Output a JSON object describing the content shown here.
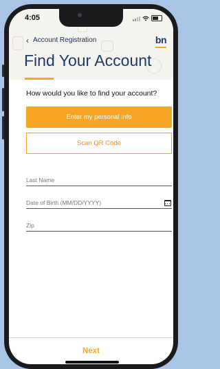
{
  "status_bar": {
    "time": "4:05"
  },
  "header": {
    "back_label": "Account Registration",
    "logo": "bn",
    "title": "Find Your Account"
  },
  "progress": {
    "steps": 5,
    "active_step": 1
  },
  "form": {
    "question": "How would you like to find your account?",
    "option_personal_info": "Enter my personal info",
    "option_qr": "Scan QR Code",
    "last_name_placeholder": "Last Name",
    "dob_placeholder": "Date of Birth (MM/DD/YYYY)",
    "zip_placeholder": "Zip"
  },
  "footer": {
    "next_label": "Next"
  },
  "colors": {
    "accent": "#f6a524",
    "brand": "#1f3a6a"
  },
  "icons": {
    "back": "chevron-left-icon",
    "calendar": "calendar-icon"
  }
}
